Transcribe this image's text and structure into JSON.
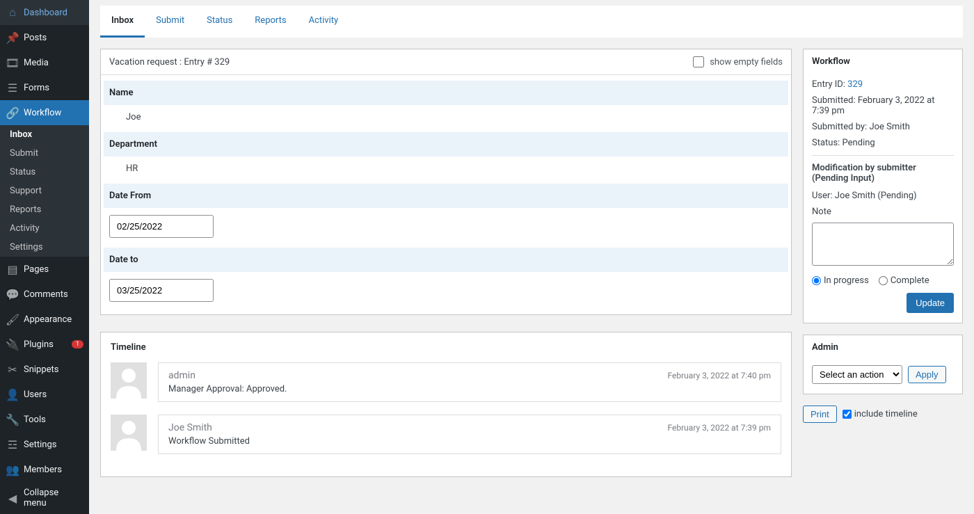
{
  "sidebar": {
    "items": [
      {
        "label": "Dashboard",
        "icon": "dashboard"
      },
      {
        "label": "Posts",
        "icon": "pin"
      },
      {
        "label": "Media",
        "icon": "media"
      },
      {
        "label": "Forms",
        "icon": "forms"
      },
      {
        "label": "Workflow",
        "icon": "link",
        "active": true
      },
      {
        "label": "Pages",
        "icon": "page"
      },
      {
        "label": "Comments",
        "icon": "comment"
      },
      {
        "label": "Appearance",
        "icon": "brush"
      },
      {
        "label": "Plugins",
        "icon": "plug",
        "badge": "1"
      },
      {
        "label": "Snippets",
        "icon": "scissors"
      },
      {
        "label": "Users",
        "icon": "user"
      },
      {
        "label": "Tools",
        "icon": "wrench"
      },
      {
        "label": "Settings",
        "icon": "sliders"
      },
      {
        "label": "Members",
        "icon": "group"
      },
      {
        "label": "Collapse menu",
        "icon": "collapse"
      }
    ],
    "submenu": [
      {
        "label": "Inbox",
        "active": true
      },
      {
        "label": "Submit"
      },
      {
        "label": "Status"
      },
      {
        "label": "Support"
      },
      {
        "label": "Reports"
      },
      {
        "label": "Activity"
      },
      {
        "label": "Settings"
      }
    ]
  },
  "tabs": [
    {
      "label": "Inbox",
      "active": true
    },
    {
      "label": "Submit"
    },
    {
      "label": "Status"
    },
    {
      "label": "Reports"
    },
    {
      "label": "Activity"
    }
  ],
  "entry": {
    "title": "Vacation request : Entry # 329",
    "show_empty_label": "show empty fields",
    "name_label": "Name",
    "name_value": "Joe",
    "dept_label": "Department",
    "dept_value": "HR",
    "date_from_label": "Date From",
    "date_from_value": "02/25/2022",
    "date_to_label": "Date to",
    "date_to_value": "03/25/2022"
  },
  "timeline": {
    "title": "Timeline",
    "items": [
      {
        "user": "admin",
        "date": "February 3, 2022 at 7:40 pm",
        "msg": "Manager Approval: Approved."
      },
      {
        "user": "Joe Smith",
        "date": "February 3, 2022 at 7:39 pm",
        "msg": "Workflow Submitted"
      }
    ]
  },
  "workflow_box": {
    "title": "Workflow",
    "entry_id_label": "Entry ID: ",
    "entry_id": "329",
    "submitted": "Submitted: February 3, 2022 at 7:39 pm",
    "submitted_by": "Submitted by: Joe Smith",
    "status": "Status: Pending",
    "mod_title": "Modification by submitter (Pending Input)",
    "user_line": "User: Joe Smith (Pending)",
    "note_label": "Note",
    "radio_inprogress": "In progress",
    "radio_complete": "Complete",
    "update_btn": "Update"
  },
  "admin_box": {
    "title": "Admin",
    "select_placeholder": "Select an action",
    "apply_btn": "Apply",
    "print_btn": "Print",
    "include_timeline": "include timeline"
  }
}
